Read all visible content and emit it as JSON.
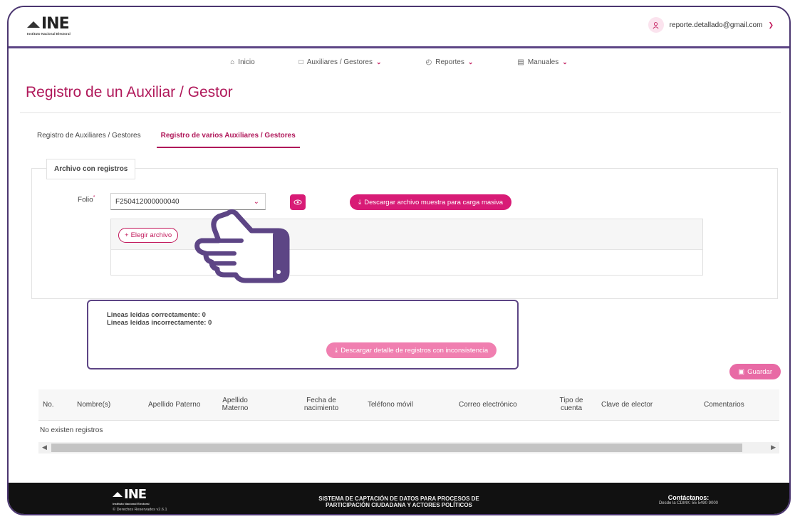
{
  "brand": {
    "wordmark": "INE",
    "subtitle": "Instituto Nacional Electoral"
  },
  "user": {
    "email": "reporte.detallado@gmail.com",
    "icon": "user-icon"
  },
  "nav": {
    "items": [
      {
        "label": "Inicio",
        "icon": "home-icon",
        "dropdown": false
      },
      {
        "label": "Auxiliares / Gestores",
        "icon": "document-icon",
        "dropdown": true
      },
      {
        "label": "Reportes",
        "icon": "clock-icon",
        "dropdown": true
      },
      {
        "label": "Manuales",
        "icon": "file-icon",
        "dropdown": true
      }
    ]
  },
  "page": {
    "title": "Registro de un Auxiliar / Gestor"
  },
  "tabs": [
    {
      "label": "Registro de Auxiliares / Gestores",
      "active": false
    },
    {
      "label": "Registro de varios Auxiliares / Gestores",
      "active": true
    }
  ],
  "upload_section": {
    "legend": "Archivo con registros",
    "folio_label": "Folio",
    "folio_required": "*",
    "folio_value": "F250412000000040",
    "download_sample_label": "Descargar archivo muestra para carga masiva",
    "choose_file_label": "Elegir archivo"
  },
  "summary": {
    "correct_lines": "Lineas leidas correctamente: 0",
    "incorrect_lines": "Lineas leidas incorrectamente: 0",
    "download_inconsistencies_label": "Descargar detalle de registros con inconsistencia"
  },
  "save_label": "Guardar",
  "table": {
    "headers": [
      "No.",
      "Nombre(s)",
      "Apellido Paterno",
      "Apellido Materno",
      "Fecha de nacimiento",
      "Teléfono móvil",
      "Correo electrónico",
      "Tipo de cuenta",
      "Clave de elector",
      "Comentarios"
    ],
    "empty_message": "No existen registros"
  },
  "footer": {
    "wordmark": "INE",
    "subtitle": "Instituto Nacional Electoral",
    "rights": "© Derechos Reservados v2.6.1",
    "center_line1": "SISTEMA DE CAPTACIÓN DE DATOS PARA PROCESOS DE",
    "center_line2": "PARTICIPACIÓN CIUDADANA Y ACTORES POLÍTICOS",
    "contact_title": "Contáctanos:",
    "contact_phone": "Desde la CDMX: 55 5490 9000"
  },
  "colors": {
    "brand_magenta": "#b0185a",
    "button_magenta": "#d81b76",
    "frame_purple": "#5d4585"
  }
}
